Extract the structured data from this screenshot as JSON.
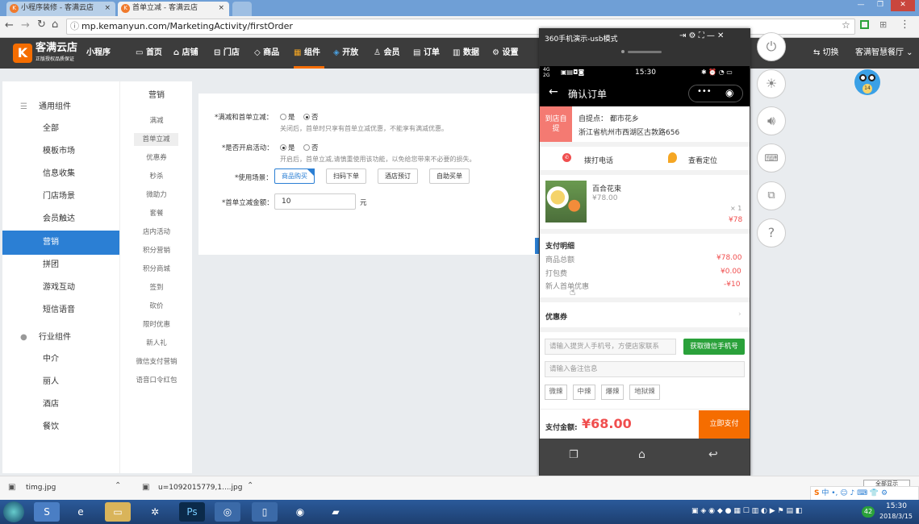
{
  "browser": {
    "tabs": [
      {
        "label": "小程序装修 - 客满云店"
      },
      {
        "label": "首单立减 - 客满云店"
      }
    ],
    "url": "mp.kemanyun.com/MarketingActivity/firstOrder"
  },
  "nav": {
    "logo": "客满云店",
    "logo_sub": "正版授权品质保证",
    "mini": "小程序",
    "items": [
      "首页",
      "店铺",
      "门店",
      "商品",
      "组件",
      "开放",
      "会员",
      "订单",
      "数据",
      "设置"
    ],
    "switch": "切换",
    "store": "客满智慧餐厅"
  },
  "sidebar": {
    "general_title": "通用组件",
    "general": [
      "全部",
      "模板市场",
      "信息收集",
      "门店场景",
      "会员触达",
      "营销",
      "拼团",
      "游戏互动",
      "短信语音"
    ],
    "industry_title": "行业组件",
    "industry": [
      "中介",
      "丽人",
      "酒店",
      "餐饮"
    ]
  },
  "submenu": {
    "title": "营销",
    "items": [
      "满减",
      "首单立减",
      "优惠券",
      "秒杀",
      "微助力",
      "套餐",
      "店内活动",
      "积分营销",
      "积分商城",
      "签到",
      "砍价",
      "限时优惠",
      "新人礼",
      "微信支付营销",
      "语音口令红包"
    ]
  },
  "form": {
    "row1_label": "*满减和首单立减：",
    "yes": "是",
    "no": "否",
    "row1_hint": "关闭后，首单时只享有首单立减优惠，不能享有满减优惠。",
    "row2_label": "*是否开启活动：",
    "row2_hint": "开启后，首单立减,请慎重使用该功能，以免给您带来不必要的损失。",
    "row3_label": "*使用场景：",
    "scenes": [
      "商品购买",
      "扫码下单",
      "酒店预订",
      "自助买单"
    ],
    "row4_label": "*首单立减金额：",
    "amount": "10",
    "unit": "元"
  },
  "phone": {
    "title": "360手机演示-usb模式",
    "status_left": "4G 2G",
    "time": "15:30",
    "page_title": "确认订单",
    "pickup_tag": "到店自提",
    "pickup_label": "自提点：",
    "pickup_name": "都市花乡",
    "address": "浙江省杭州市西湖区古敦路656",
    "call": "拨打电话",
    "locate": "查看定位",
    "product_name": "百合花束",
    "product_price": "¥78.00",
    "qty": "× 1",
    "subtotal": "¥78",
    "pay_detail": "支付明细",
    "rows": [
      {
        "k": "商品总额",
        "v": "¥78.00"
      },
      {
        "k": "打包费",
        "v": "¥0.00"
      },
      {
        "k": "新人首单优惠",
        "v": "-¥10"
      }
    ],
    "coupon": "优惠券",
    "phone_placeholder": "请输入提货人手机号，方便店家联系",
    "wx_btn": "获取微信手机号",
    "note_placeholder": "请输入备注信息",
    "tags": [
      "微辣",
      "中辣",
      "爆辣",
      "地狱辣"
    ],
    "pay_label": "支付金额:",
    "pay_amount": "¥68.00",
    "pay_btn": "立即支付"
  },
  "downloads": [
    {
      "name": "timg.jpg"
    },
    {
      "name": "u=1092015779,1....jpg"
    }
  ],
  "show_all": "全部显示",
  "taskbar": {
    "time": "15:30",
    "date": "2018/3/15",
    "badge": "42"
  },
  "colors": {
    "accent": "#2b7fd4",
    "orange": "#f56d00",
    "price": "#f04e4e",
    "green": "#2aa13a"
  }
}
